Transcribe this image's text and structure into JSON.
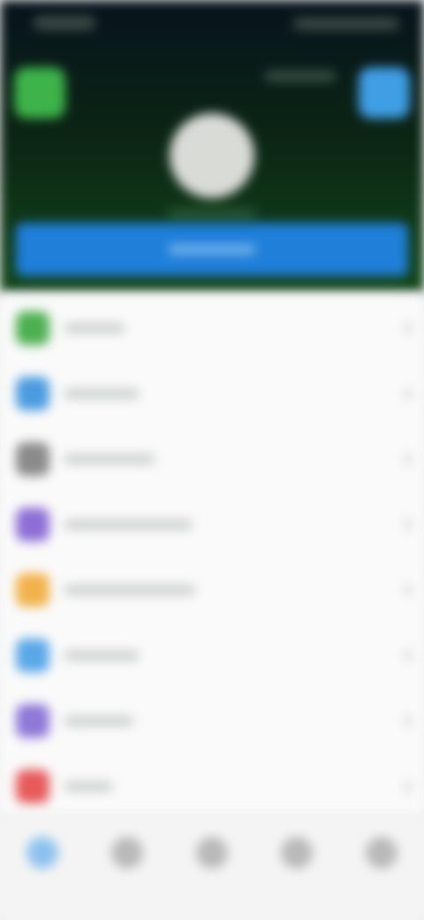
{
  "header": {
    "left_button_icon": "green-app-icon",
    "right_button_icon": "blue-app-icon",
    "avatar_icon": "profile-avatar-icon",
    "cta_label": ""
  },
  "menu_items": [
    {
      "label": "",
      "icon": "green-icon",
      "color": "#4caf50"
    },
    {
      "label": "",
      "icon": "blue-icon",
      "color": "#4a9be0"
    },
    {
      "label": "",
      "icon": "gray-icon",
      "color": "#8a8a8a"
    },
    {
      "label": "",
      "icon": "purple-icon",
      "color": "#8d6ed6"
    },
    {
      "label": "",
      "icon": "orange-icon",
      "color": "#f2b24a"
    },
    {
      "label": "",
      "icon": "light-blue-icon",
      "color": "#5aa8e8"
    },
    {
      "label": "",
      "icon": "violet-icon",
      "color": "#8e78d8"
    },
    {
      "label": "",
      "icon": "red-icon",
      "color": "#e85a5a"
    }
  ],
  "tabs": [
    {
      "label": "",
      "icon": "home-tab-icon",
      "active": true
    },
    {
      "label": "",
      "icon": "tab-2-icon",
      "active": false
    },
    {
      "label": "",
      "icon": "tab-3-icon",
      "active": false
    },
    {
      "label": "",
      "icon": "tab-4-icon",
      "active": false
    },
    {
      "label": "",
      "icon": "tab-5-icon",
      "active": false
    }
  ]
}
